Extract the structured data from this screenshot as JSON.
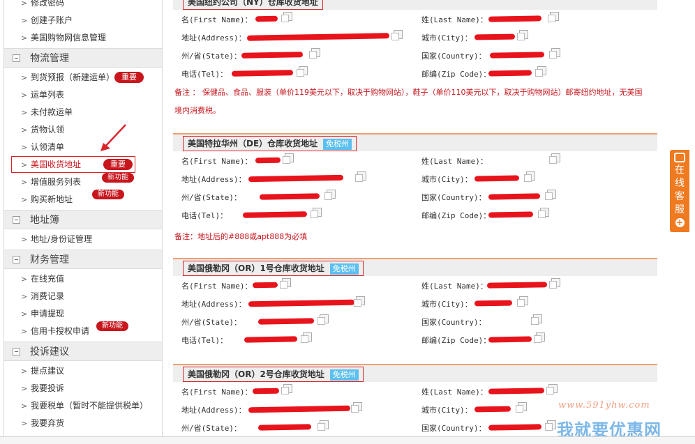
{
  "sidebar": {
    "top_items": [
      "修改密码",
      "创建子账户",
      "美国购物网信息管理"
    ],
    "groups": [
      {
        "title": "物流管理",
        "items": [
          {
            "label": "到货预报（新建运单）",
            "badge": "重要"
          },
          {
            "label": "运单列表"
          },
          {
            "label": "未付款运单"
          },
          {
            "label": "货物认领"
          },
          {
            "label": "认领清单"
          },
          {
            "label": "美国收货地址",
            "badge": "重要",
            "highlighted": true
          },
          {
            "label": "增值服务列表",
            "badge": "新功能"
          },
          {
            "label": "购买新地址",
            "badge": "新功能"
          }
        ]
      },
      {
        "title": "地址簿",
        "items": [
          {
            "label": "地址/身份证管理"
          }
        ]
      },
      {
        "title": "财务管理",
        "items": [
          {
            "label": "在线充值"
          },
          {
            "label": "消费记录"
          },
          {
            "label": "申请提现"
          },
          {
            "label": "信用卡授权申请",
            "badge": "新功能"
          }
        ]
      },
      {
        "title": "投诉建议",
        "items": [
          {
            "label": "提点建议"
          },
          {
            "label": "我要投诉"
          },
          {
            "label": "我要税单（暂时不能提供税单）"
          },
          {
            "label": "我要弃货"
          }
        ]
      }
    ]
  },
  "labels": {
    "first_name": "名(First Name)：",
    "last_name": "姓(Last Name)：",
    "address": "地址(Address)：",
    "city": "城市(City)：",
    "state": "州/省(State)：",
    "country": "国家(Country)：",
    "tel": "电话(Tel)：",
    "zip": "邮编(Zip Code)："
  },
  "sections": [
    {
      "title": "美国纽约公司（NY）仓库收货地址",
      "tax_free": "",
      "note": "备注 ： 保健品、食品、服装（单价119美元以下，取决于购物网站），鞋子（单价110美元以下，取决于购物网站）邮寄纽约地址，无美国境内消费税。"
    },
    {
      "title": "美国特拉华州（DE）仓库收货地址",
      "tax_free": "免税州",
      "note": "备注：地址后的#888或apt888为必填"
    },
    {
      "title": "美国俄勒冈（OR）1号仓库收货地址",
      "tax_free": "免税州",
      "note": ""
    },
    {
      "title": "美国俄勒冈（OR）2号仓库收货地址",
      "tax_free": "免税州",
      "note": ""
    }
  ],
  "service": {
    "label": "在线客服"
  },
  "watermark": {
    "url": "www.591yhw.com",
    "name": "我就要优惠网"
  },
  "colors": {
    "accent_red": "#c8161d",
    "redaction": "#e8141c",
    "service_orange": "#f07a20",
    "tax_free_blue": "#5bc0f0"
  }
}
